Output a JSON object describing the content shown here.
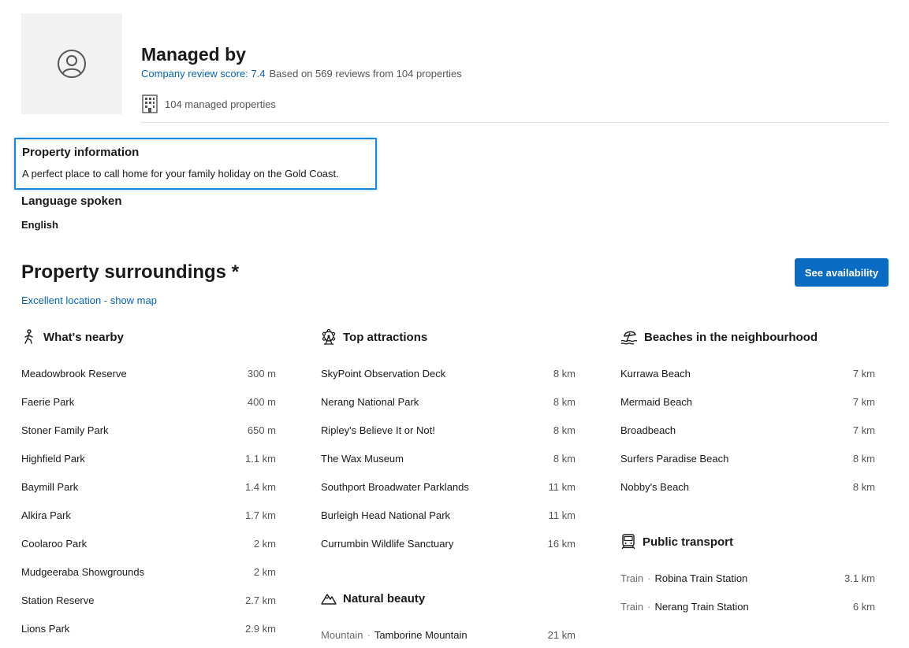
{
  "header": {
    "title": "Managed by",
    "review_score": "Company review score: 7.4",
    "review_based": "Based on 569 reviews from 104 properties",
    "managed_properties": "104 managed properties"
  },
  "property_information": {
    "title": "Property information",
    "description": "A perfect place to call home for your family holiday on the Gold Coast."
  },
  "language": {
    "title": "Language spoken",
    "value": "English"
  },
  "surroundings": {
    "title": "Property surroundings *",
    "location_link": "Excellent location - show map",
    "availability_button": "See availability"
  },
  "whats_nearby": {
    "title": "What's nearby",
    "icon": "walking-person-icon",
    "items": [
      {
        "name": "Meadowbrook Reserve",
        "distance": "300 m"
      },
      {
        "name": "Faerie Park",
        "distance": "400 m"
      },
      {
        "name": "Stoner Family Park",
        "distance": "650 m"
      },
      {
        "name": "Highfield Park",
        "distance": "1.1 km"
      },
      {
        "name": "Baymill Park",
        "distance": "1.4 km"
      },
      {
        "name": "Alkira Park",
        "distance": "1.7 km"
      },
      {
        "name": "Coolaroo Park",
        "distance": "2 km"
      },
      {
        "name": "Mudgeeraba Showgrounds",
        "distance": "2 km"
      },
      {
        "name": "Station Reserve",
        "distance": "2.7 km"
      },
      {
        "name": "Lions Park",
        "distance": "2.9 km"
      }
    ]
  },
  "top_attractions": {
    "title": "Top attractions",
    "icon": "ferris-wheel-icon",
    "items": [
      {
        "name": "SkyPoint Observation Deck",
        "distance": "8 km"
      },
      {
        "name": "Nerang National Park",
        "distance": "8 km"
      },
      {
        "name": "Ripley's Believe It or Not!",
        "distance": "8 km"
      },
      {
        "name": "The Wax Museum",
        "distance": "8 km"
      },
      {
        "name": "Southport Broadwater Parklands",
        "distance": "11 km"
      },
      {
        "name": "Burleigh Head National Park",
        "distance": "11 km"
      },
      {
        "name": "Currumbin Wildlife Sanctuary",
        "distance": "16 km"
      }
    ]
  },
  "natural_beauty": {
    "title": "Natural beauty",
    "icon": "mountain-icon",
    "items": [
      {
        "type": "Mountain",
        "name": "Tamborine Mountain",
        "distance": "21 km"
      }
    ]
  },
  "beaches": {
    "title": "Beaches in the neighbourhood",
    "icon": "beach-icon",
    "items": [
      {
        "name": "Kurrawa Beach",
        "distance": "7 km"
      },
      {
        "name": "Mermaid Beach",
        "distance": "7 km"
      },
      {
        "name": "Broadbeach",
        "distance": "7 km"
      },
      {
        "name": "Surfers Paradise Beach",
        "distance": "8 km"
      },
      {
        "name": "Nobby's Beach",
        "distance": "8 km"
      }
    ]
  },
  "public_transport": {
    "title": "Public transport",
    "icon": "train-icon",
    "items": [
      {
        "type": "Train",
        "name": "Robina Train Station",
        "distance": "3.1 km"
      },
      {
        "type": "Train",
        "name": "Nerang Train Station",
        "distance": "6 km"
      }
    ]
  }
}
